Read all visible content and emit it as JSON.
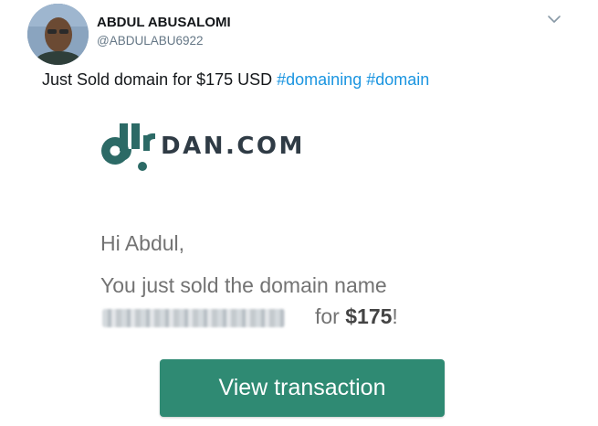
{
  "author": {
    "display_name": "ABDUL ABUSALOMI",
    "handle": "@ABDULABU6922"
  },
  "tweet": {
    "text": "Just Sold domain for $175 USD ",
    "hashtags": [
      "#domaining",
      "#domain"
    ]
  },
  "email": {
    "logo_text": "DAN.COM",
    "greeting": "Hi Abdul,",
    "sold_text": "You just sold the domain name",
    "for_text": "for ",
    "price": "$175",
    "exclaim": "!",
    "button_label": "View transaction"
  },
  "colors": {
    "hashtag": "#1b95e0",
    "brand": "#2c6a66",
    "button": "#2f8a73"
  },
  "icons": {
    "menu": "chevron-down-icon"
  }
}
